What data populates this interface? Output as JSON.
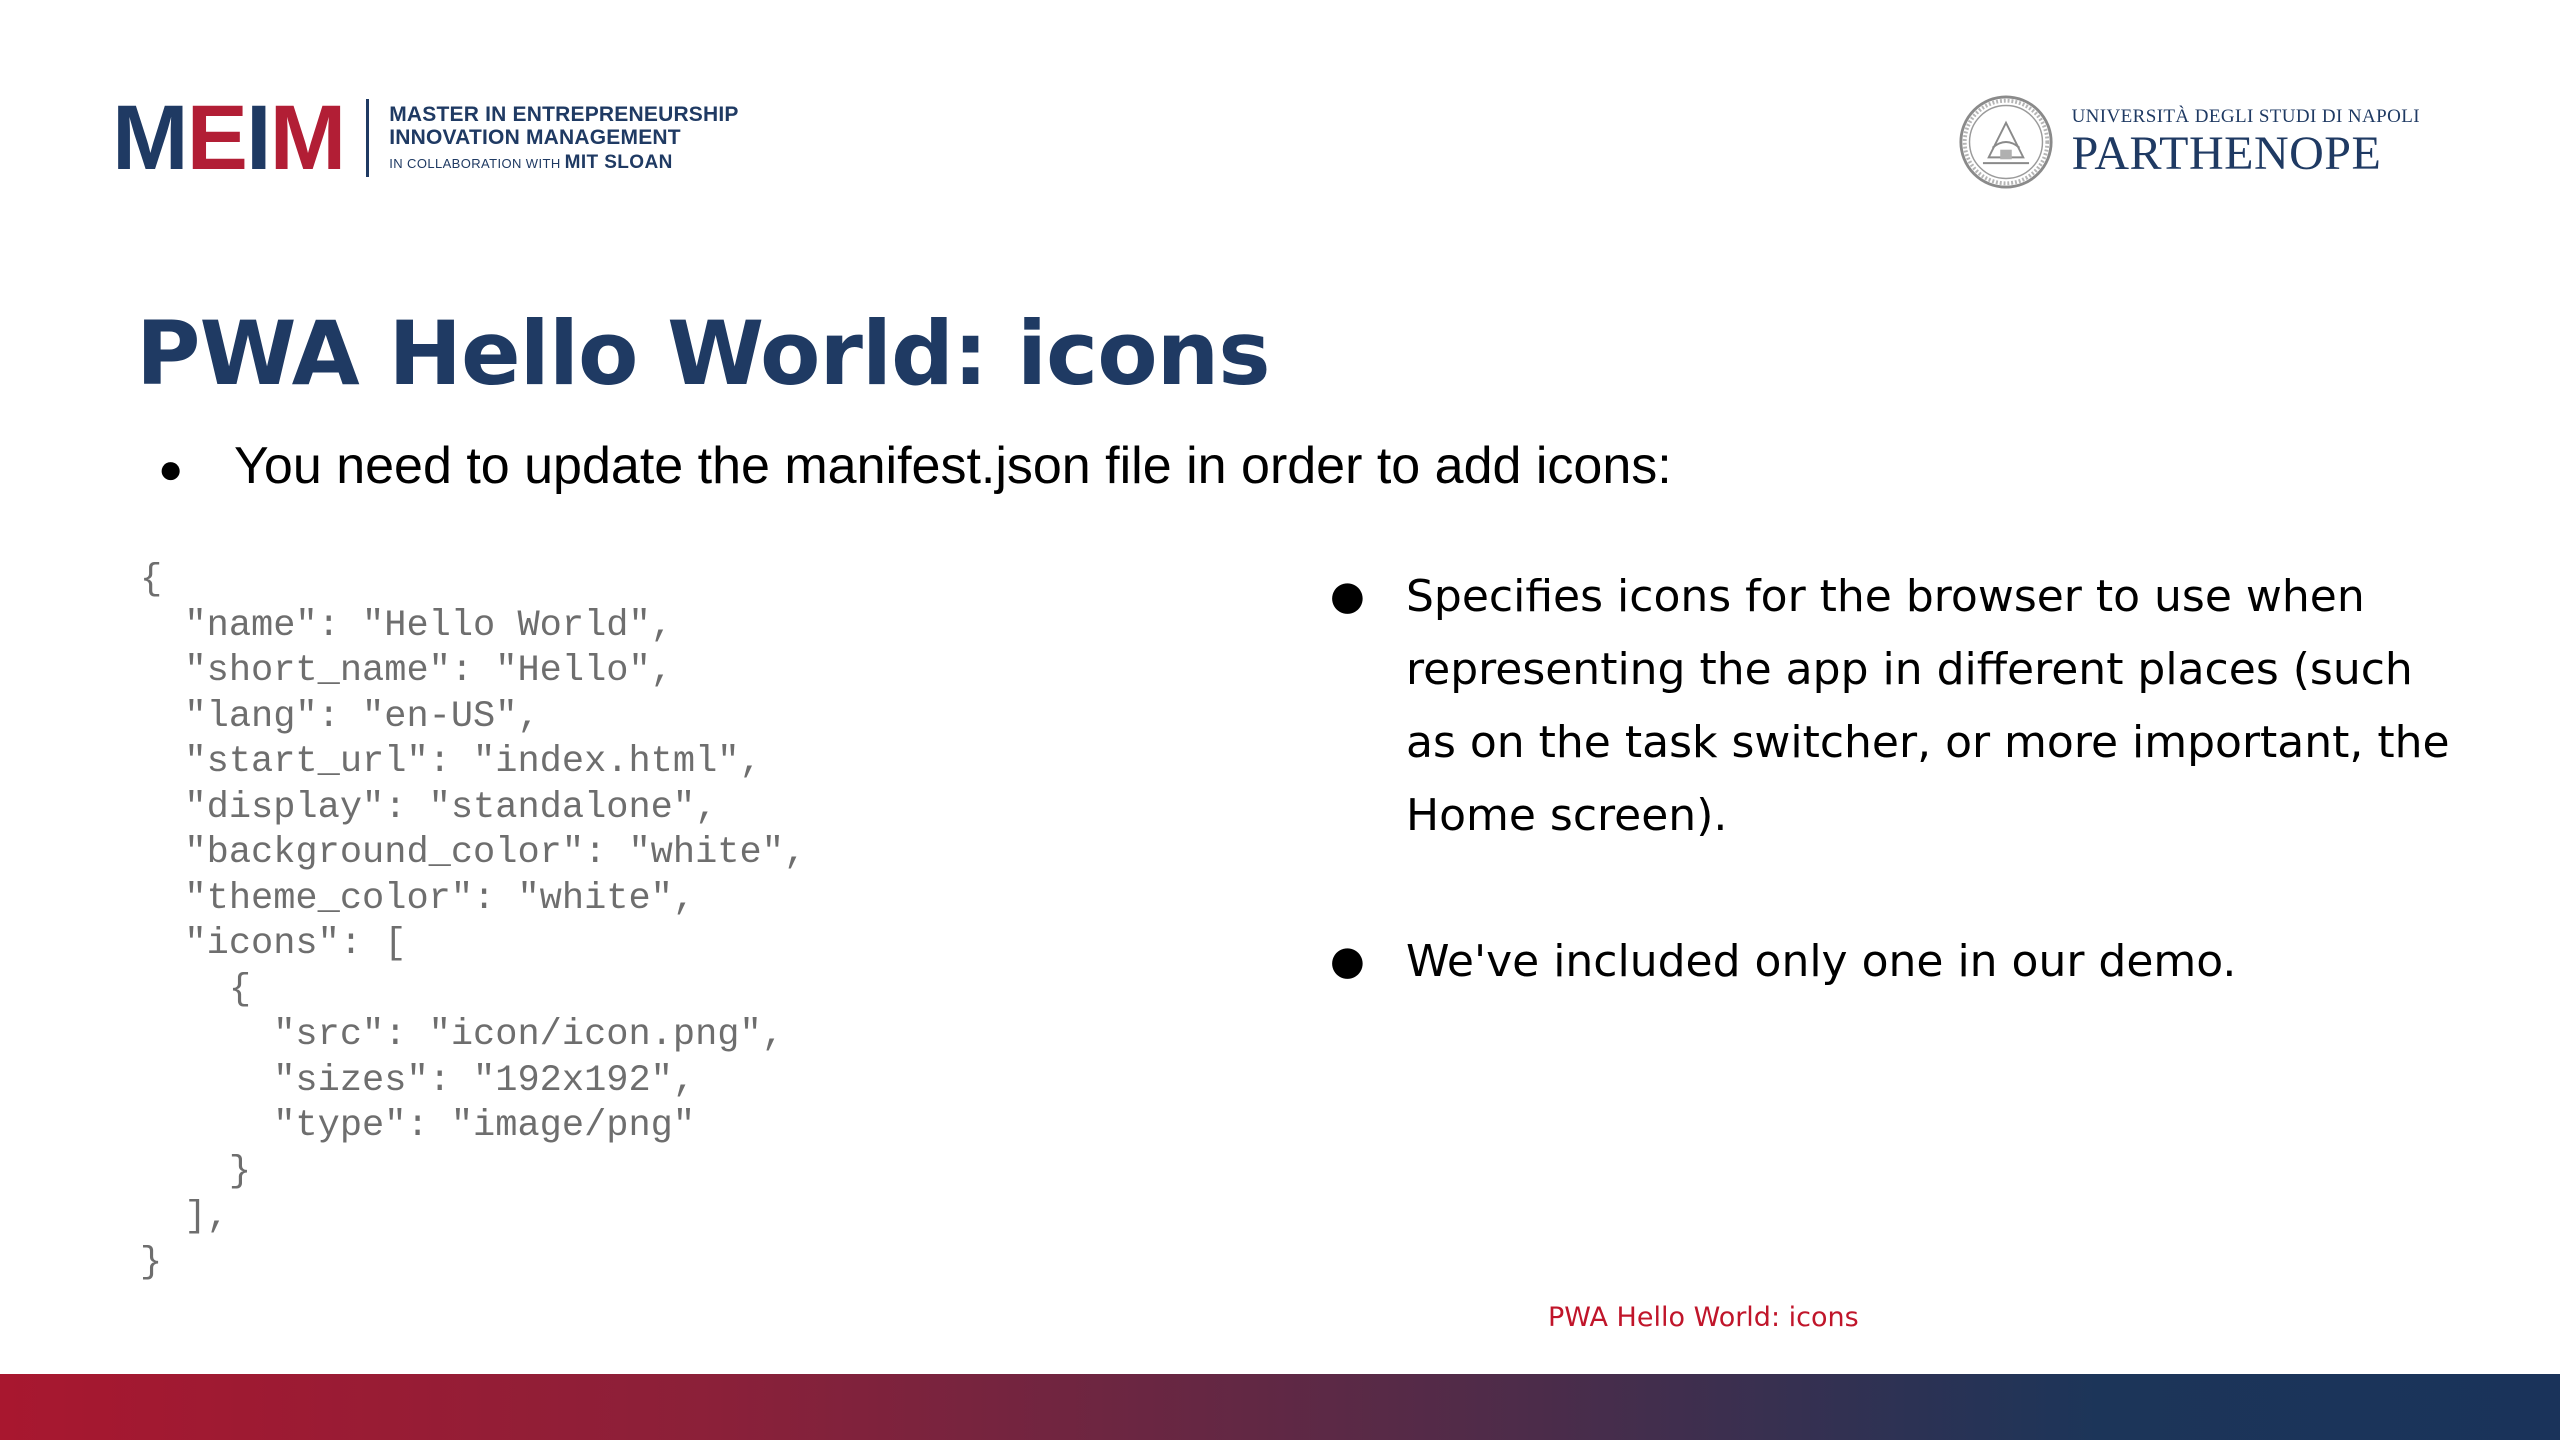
{
  "header": {
    "meim_logo": {
      "letters": [
        "M",
        "E",
        "I",
        "M"
      ],
      "line1": "MASTER IN ENTREPRENEURSHIP",
      "line2": "INNOVATION MANAGEMENT",
      "line3_prefix": "IN COLLABORATION WITH",
      "line3_strong": "MIT SLOAN",
      "colors": {
        "navy": "#1f3a63",
        "red": "#b21e35"
      }
    },
    "university_logo": {
      "line1": "UNIVERSITÀ DEGLI STUDI DI NAPOLI",
      "line2": "PARTHENOPE",
      "icon": "university-seal-icon"
    }
  },
  "slide": {
    "title": "PWA Hello World: icons",
    "intro_bullet": "You need to update the manifest.json file in order to add icons:",
    "code_lines": [
      "{",
      "  \"name\": \"Hello World\",",
      "  \"short_name\": \"Hello\",",
      "  \"lang\": \"en-US\",",
      "  \"start_url\": \"index.html\",",
      "  \"display\": \"standalone\",",
      "  \"background_color\": \"white\",",
      "  \"theme_color\": \"white\",",
      "  \"icons\": [",
      "    {",
      "      \"src\": \"icon/icon.png\",",
      "      \"sizes\": \"192x192\",",
      "      \"type\": \"image/png\"",
      "    }",
      "  ],",
      "}"
    ],
    "right_bullets": [
      "Specifies icons for the browser to use when representing the app in different places (such as on the task switcher, or more important, the Home screen).",
      "We've included only one in our demo."
    ],
    "bullet_glyph": "●"
  },
  "footer": {
    "label": "PWA Hello World: icons",
    "label_color": "#c0152a",
    "bar_colors": [
      "#a8172f",
      "#1a335a"
    ]
  },
  "colors": {
    "title": "#1f3a63",
    "code_text": "#6e6e6e",
    "body_text": "#000000"
  }
}
